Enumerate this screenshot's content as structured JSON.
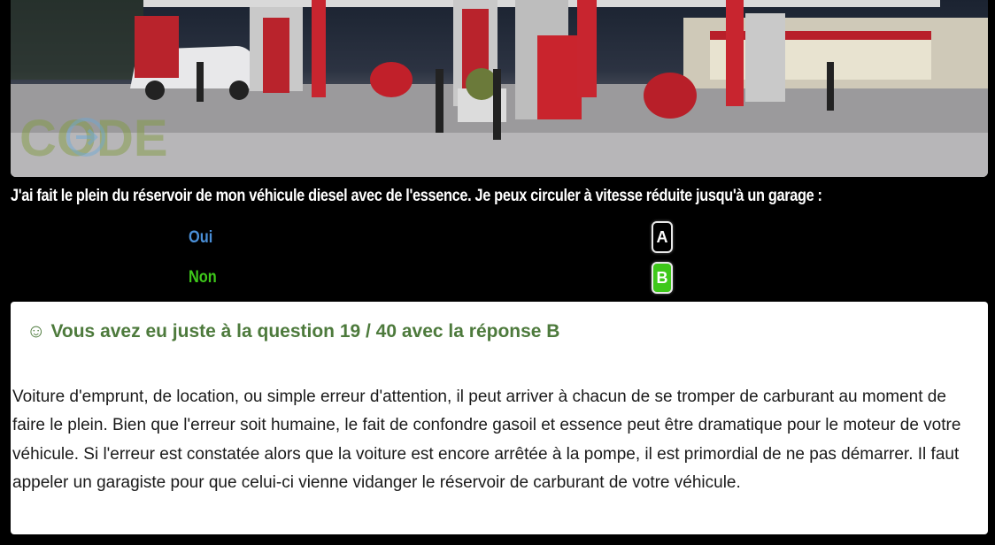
{
  "hero_image": {
    "watermark_text": "CODE",
    "description_icon": "gas-station-photo"
  },
  "question": "J'ai fait le plein du réservoir de mon véhicule diesel avec de l'essence. Je peux circuler à vitesse réduite jusqu'à un garage :",
  "answers": [
    {
      "label": "Oui",
      "key": "A",
      "color": "#4a8fd8",
      "selected": false
    },
    {
      "label": "Non",
      "key": "B",
      "color": "#3ec81a",
      "selected": true
    }
  ],
  "result": {
    "icon": "smile-icon",
    "text": "Vous avez eu juste à la question 19 / 40 avec la réponse B"
  },
  "explanation": "Voiture d'emprunt, de location, ou simple erreur d'attention, il peut arriver à chacun de se tromper de carburant au moment de faire le plein. Bien que l'erreur soit humaine, le fait de confondre gasoil et essence peut être dramatique pour le moteur de votre véhicule. Si l'erreur est constatée alors que la voiture est encore arrêtée à la pompe, il est primordial de ne pas démarrer. Il faut appeler un garagiste pour que celui-ci vienne vidanger le réservoir de carburant de votre véhicule.",
  "colors": {
    "correct_green": "#3ec81a",
    "result_text": "#4d7a3c",
    "answer_blue": "#4a8fd8"
  }
}
